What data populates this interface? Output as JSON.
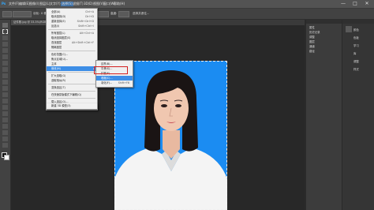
{
  "app": {
    "logo": "Ps"
  },
  "menubar": {
    "items": [
      "文件(F)",
      "编辑(E)",
      "图像(I)",
      "图层(L)",
      "文字(Y)",
      "选择(S)",
      "滤镜(T)",
      "3D(D)",
      "视图(V)",
      "窗口(W)",
      "帮助(H)"
    ],
    "controls": [
      "—",
      "□",
      "✕"
    ]
  },
  "options": {
    "labels": [
      "羽化:",
      "0 像素",
      "消除锯齿",
      "样式:",
      "正常",
      "宽度:",
      "高度:",
      "选择并遮住..."
    ]
  },
  "tabs": [
    "证件照.jpg @ 33.3%(RGB/8#)"
  ],
  "select_menu": {
    "items": [
      {
        "label": "全部(A)",
        "shortcut": "Ctrl+A"
      },
      {
        "label": "取消选择(D)",
        "shortcut": "Ctrl+D"
      },
      {
        "label": "重新选择(E)",
        "shortcut": "Shift+Ctrl+D"
      },
      {
        "label": "反选(I)",
        "shortcut": "Shift+Ctrl+I"
      },
      {
        "label": "所有图层(L)",
        "shortcut": "Alt+Ctrl+A"
      },
      {
        "label": "取消选择图层(S)",
        "shortcut": ""
      },
      {
        "label": "查找图层",
        "shortcut": "Alt+Shift+Ctrl+F"
      },
      {
        "label": "隔离图层",
        "shortcut": ""
      },
      {
        "label": "色彩范围(C)...",
        "shortcut": ""
      },
      {
        "label": "焦点区域(U)...",
        "shortcut": ""
      },
      {
        "label": "主体",
        "shortcut": ""
      },
      {
        "label": "选择并遮住(K)...",
        "shortcut": "Alt+Ctrl+R"
      },
      {
        "label": "修改(M)",
        "shortcut": ""
      },
      {
        "label": "扩大选取(G)",
        "shortcut": ""
      },
      {
        "label": "选取相似(R)",
        "shortcut": ""
      },
      {
        "label": "变换选区(T)",
        "shortcut": ""
      },
      {
        "label": "在快速蒙版模式下编辑(Q)",
        "shortcut": ""
      },
      {
        "label": "载入选区(O)...",
        "shortcut": ""
      },
      {
        "label": "存储选区(V)...",
        "shortcut": ""
      },
      {
        "label": "新建 3D 模型(3)",
        "shortcut": ""
      }
    ]
  },
  "modify_submenu": {
    "items": [
      {
        "label": "边界(B)...",
        "shortcut": ""
      },
      {
        "label": "平滑(S)...",
        "shortcut": ""
      },
      {
        "label": "扩展(E)...",
        "shortcut": ""
      },
      {
        "label": "收缩(C)...",
        "shortcut": ""
      },
      {
        "label": "羽化(F)...",
        "shortcut": "Shift+F6"
      }
    ]
  },
  "panels": {
    "mid": [
      "属性",
      "历史记录",
      "调整",
      "图层",
      "通道",
      "路径"
    ],
    "right": [
      "颜色",
      "色板",
      "学习",
      "库",
      "调整",
      "样式"
    ]
  },
  "colors": {
    "photo_bg": "#1b8cf2",
    "highlight": "#3d8ee6",
    "callout": "#d32020"
  }
}
